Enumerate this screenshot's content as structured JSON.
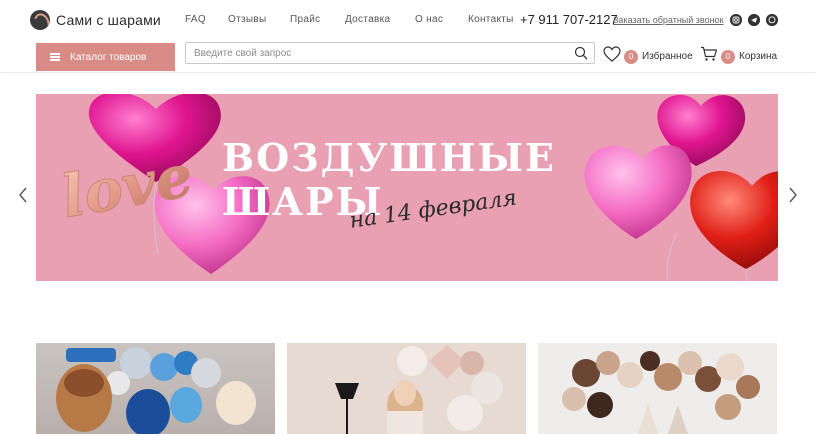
{
  "header": {
    "logo_text": "Сами с шарами",
    "nav": [
      "FAQ",
      "Отзывы",
      "Прайс",
      "Доставка",
      "О нас",
      "Контакты"
    ],
    "phone": "+7 911 707-2127",
    "callback_label": "Заказать обратный звонок",
    "social_icons": [
      "instagram-icon",
      "telegram-icon",
      "whatsapp-icon"
    ]
  },
  "toolbar": {
    "catalog_label": "Каталог товаров",
    "search_placeholder": "Введите свой запрос",
    "favorites_count": "0",
    "favorites_label": "Избранное",
    "cart_count": "0",
    "cart_label": "Корзина"
  },
  "banner": {
    "title": "ВОЗДУШНЫЕ ШАРЫ",
    "subtitle": "на 14 февраля",
    "foil_word": "love",
    "background_color": "#e9a0b2"
  },
  "colors": {
    "accent": "#d98b86",
    "banner_pink": "#e9a0b2"
  },
  "products": [
    {
      "image": "balloons-paw-patrol"
    },
    {
      "image": "balloons-girl-room"
    },
    {
      "image": "balloons-brown-arch"
    }
  ]
}
